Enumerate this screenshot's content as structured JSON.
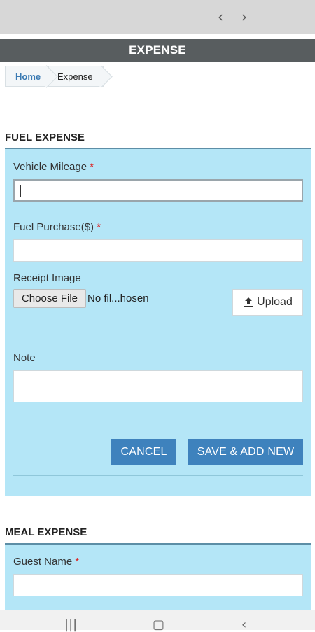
{
  "browser": {
    "back_icon": "chevron-left-icon",
    "forward_icon": "chevron-right-icon",
    "back_glyph": "‹",
    "forward_glyph": "›"
  },
  "header": {
    "title": "EXPENSE"
  },
  "breadcrumb": [
    {
      "label": "Home"
    },
    {
      "label": "Expense"
    }
  ],
  "fuel": {
    "section_title": "FUEL EXPENSE",
    "mileage_label": "Vehicle Mileage",
    "purchase_label": "Fuel Purchase($)",
    "required_mark": "*",
    "receipt_label": "Receipt Image",
    "choose_file_label": "Choose File",
    "file_status": "No fil...hosen",
    "upload_label": "Upload",
    "note_label": "Note",
    "cancel_label": "CANCEL",
    "save_label": "SAVE & ADD NEW",
    "mileage_value": "",
    "purchase_value": "",
    "note_value": ""
  },
  "meal": {
    "section_title": "MEAL EXPENSE",
    "guest_label": "Guest Name",
    "required_mark": "*",
    "guest_value": ""
  },
  "colors": {
    "header_bg": "#585d5f",
    "panel_bg": "#b4e6f7",
    "button_bg": "#3e82bd"
  }
}
